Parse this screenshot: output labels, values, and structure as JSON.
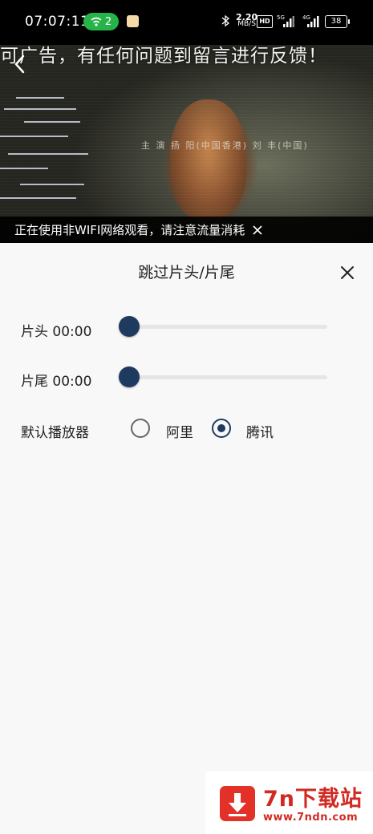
{
  "status_bar": {
    "time": "07:07:11",
    "wifi_count": "2",
    "net_speed_value": "2.20",
    "net_speed_unit": "MB/S",
    "hd_label": "HD",
    "signal1_label": "5G",
    "signal2_label": "4G",
    "battery": "38"
  },
  "video": {
    "marquee": "可广告，有任何问题到留言进行反馈！",
    "banknote_text": "主 演 扬 阳(中国香港) 刘 丰(中国)",
    "warning": "正在使用非WIFI网络观看，请注意流量消耗"
  },
  "panel": {
    "title": "跳过片头/片尾",
    "intro_label": "片头 00:00",
    "intro_value": 0,
    "outro_label": "片尾 00:00",
    "outro_value": 0,
    "player_label": "默认播放器",
    "options": [
      {
        "label": "阿里",
        "selected": false
      },
      {
        "label": "腾讯",
        "selected": true
      }
    ]
  },
  "watermark": {
    "title": "7n下载站",
    "url": "www.7ndn.com"
  },
  "colors": {
    "accent": "#1f3a5f",
    "wifi_pill": "#25b34a",
    "watermark_red": "#d12a22"
  }
}
